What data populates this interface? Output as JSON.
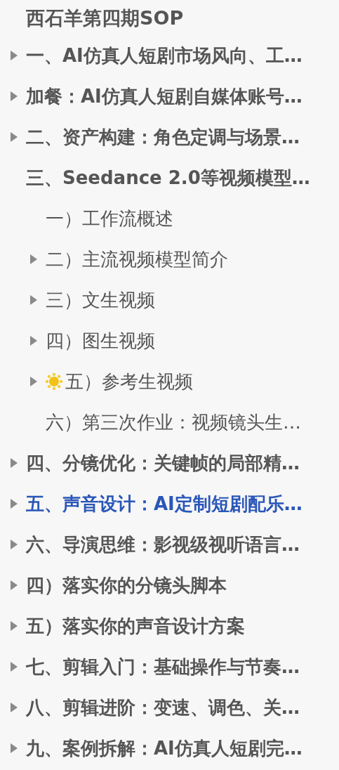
{
  "title": "西石羊第四期SOP",
  "items": [
    {
      "label": "一、AI仿真人短剧市场风向、工…",
      "collapsed": true,
      "selected": false
    },
    {
      "label": "加餐：AI仿真人短剧自媒体账号…",
      "collapsed": true,
      "selected": false
    },
    {
      "label": "二、资产构建：角色定调与场景…",
      "collapsed": true,
      "selected": false
    },
    {
      "label": "三、Seedance 2.0等视频模型…",
      "collapsed": false,
      "selected": false,
      "children": [
        {
          "label": "一）工作流概述",
          "collapsed": false,
          "marked": false
        },
        {
          "label": "二）主流视频模型简介",
          "collapsed": true,
          "marked": false
        },
        {
          "label": "三）文生视频",
          "collapsed": true,
          "marked": false
        },
        {
          "label": "四）图生视频",
          "collapsed": true,
          "marked": false
        },
        {
          "label": "五）参考生视频",
          "collapsed": true,
          "marked": true
        },
        {
          "label": "六）第三次作业：视频镜头生…",
          "collapsed": false,
          "marked": false
        }
      ]
    },
    {
      "label": "四、分镜优化：关键帧的局部精…",
      "collapsed": true,
      "selected": false
    },
    {
      "label": "五、声音设计：AI定制短剧配乐…",
      "collapsed": true,
      "selected": true
    },
    {
      "label": "六、导演思维：影视级视听语言…",
      "collapsed": true,
      "selected": false
    },
    {
      "label": "四）落实你的分镜头脚本",
      "collapsed": true,
      "selected": false
    },
    {
      "label": "五）落实你的声音设计方案",
      "collapsed": true,
      "selected": false
    },
    {
      "label": "七、剪辑入门：基础操作与节奏…",
      "collapsed": true,
      "selected": false
    },
    {
      "label": "八、剪辑进阶：变速、调色、关…",
      "collapsed": true,
      "selected": false
    },
    {
      "label": "九、案例拆解：AI仿真人短剧完…",
      "collapsed": true,
      "selected": false
    }
  ]
}
